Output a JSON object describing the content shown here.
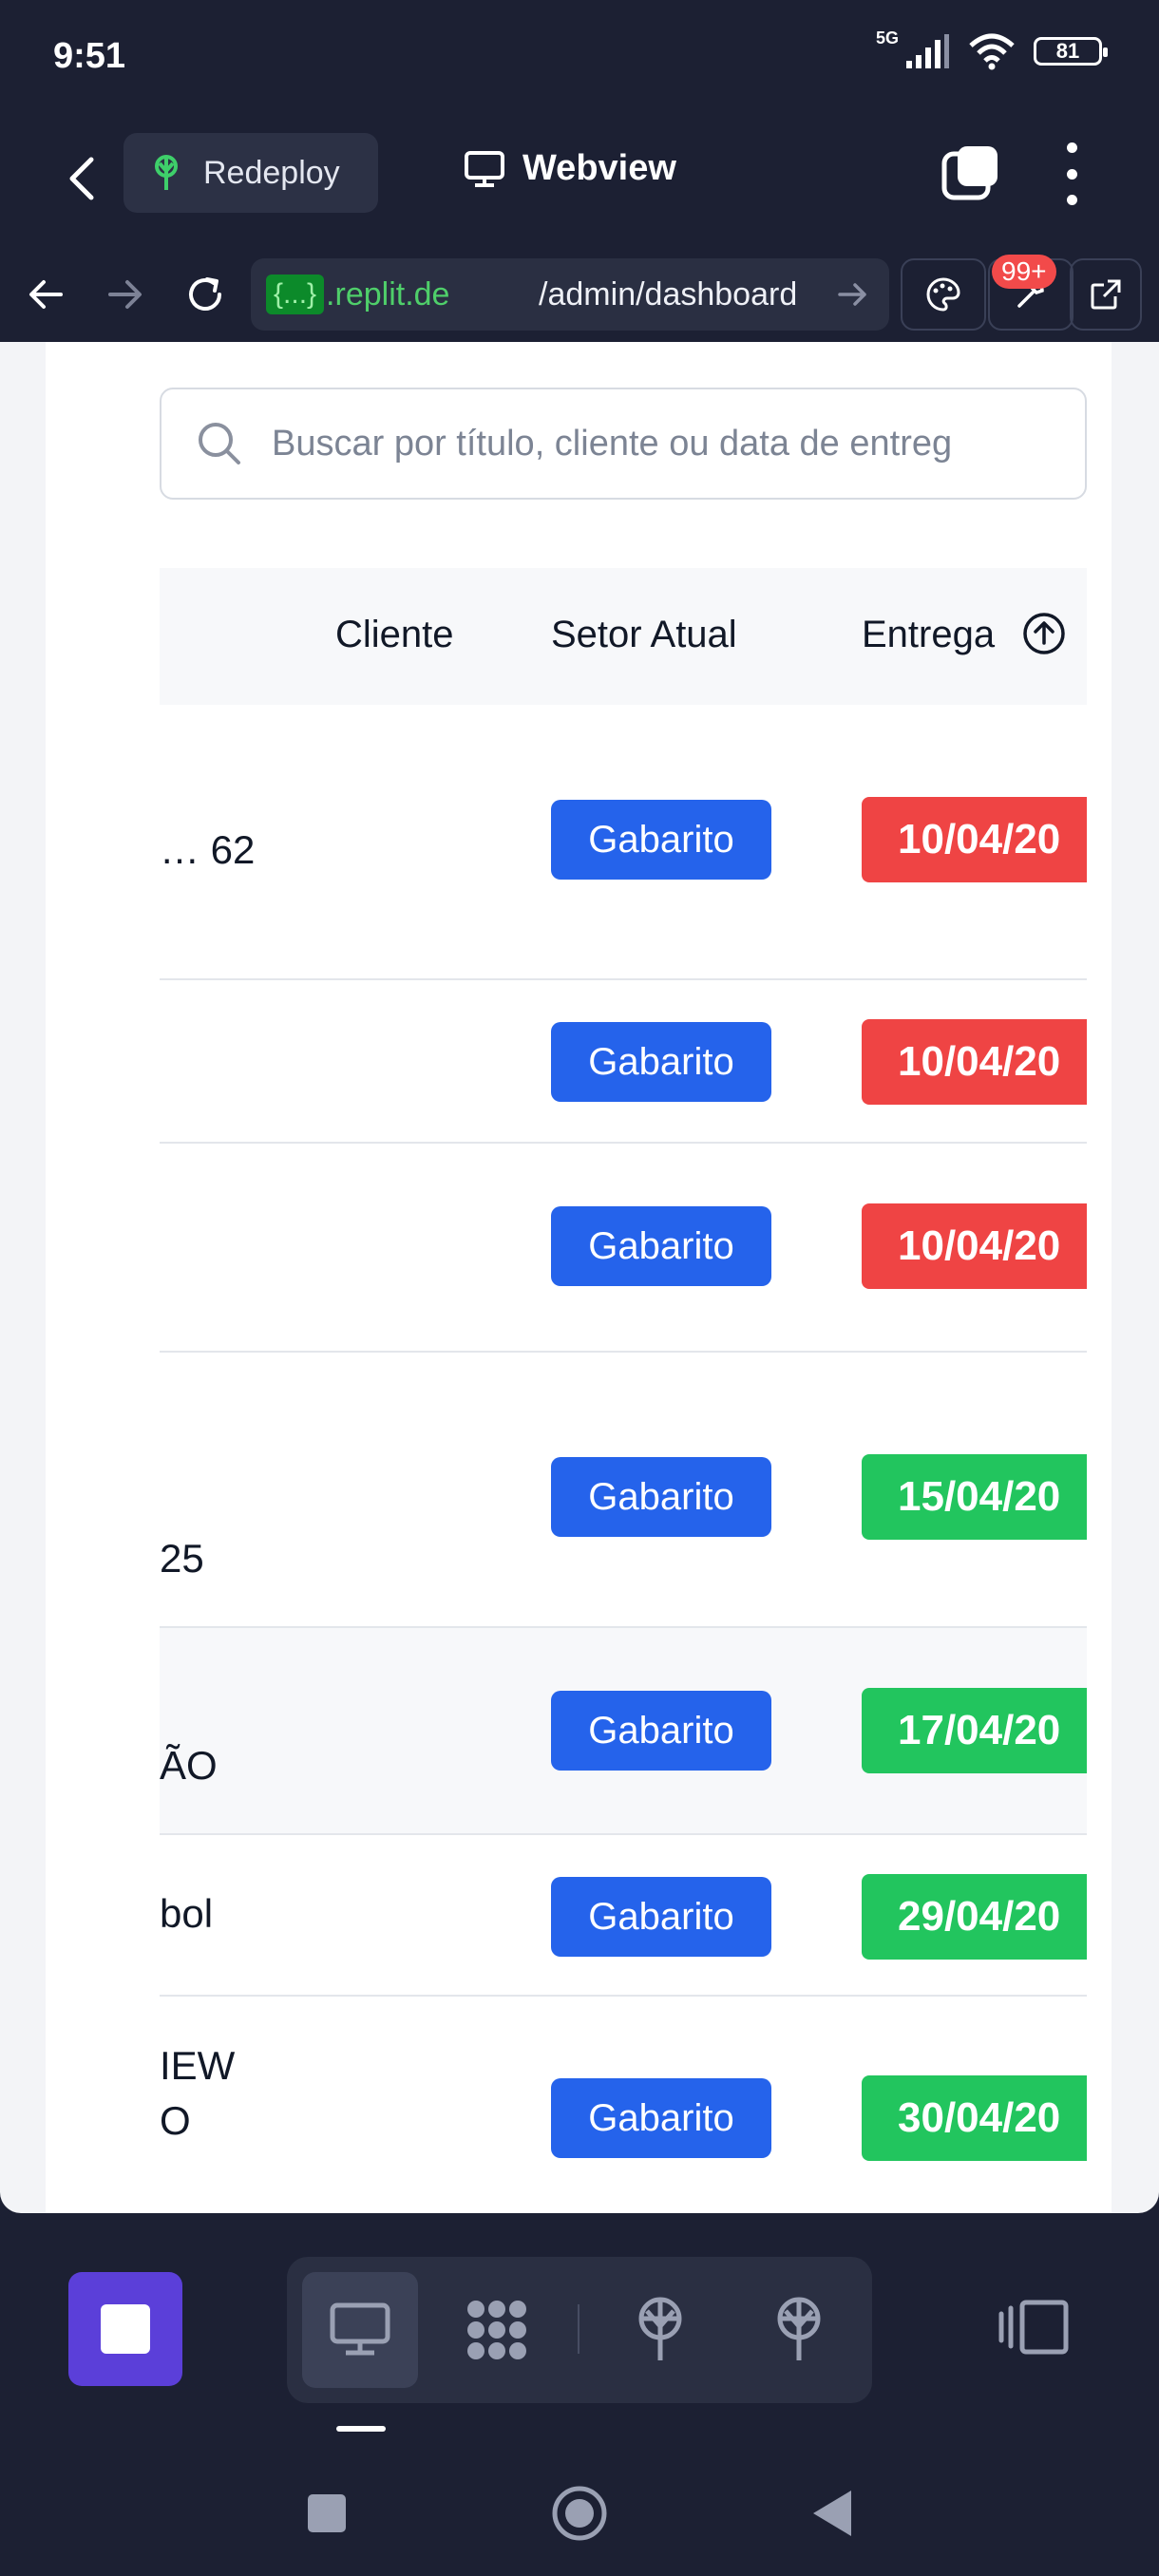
{
  "status": {
    "time": "9:51",
    "network": "5G",
    "battery": "81"
  },
  "app_bar": {
    "redeploy_label": "Redeploy",
    "tab_label": "Webview"
  },
  "url_bar": {
    "brace": "{...}",
    "domain": ".replit.de",
    "path": "/admin/dashboard",
    "badge": "99+"
  },
  "search": {
    "placeholder": "Buscar por título, cliente ou data de entreg"
  },
  "table": {
    "headers": {
      "client": "Cliente",
      "sector": "Setor Atual",
      "due": "Entrega"
    },
    "rows": [
      {
        "title_lines": [
          "… 62"
        ],
        "sector": "Gabarito",
        "due": "10/04/20",
        "status": "overdue"
      },
      {
        "title_lines": [
          ""
        ],
        "sector": "Gabarito",
        "due": "10/04/20",
        "status": "overdue"
      },
      {
        "title_lines": [
          ""
        ],
        "sector": "Gabarito",
        "due": "10/04/20",
        "status": "overdue"
      },
      {
        "title_lines": [
          "25"
        ],
        "sector": "Gabarito",
        "due": "15/04/20",
        "status": "ok"
      },
      {
        "title_lines": [
          "ÃO"
        ],
        "sector": "Gabarito",
        "due": "17/04/20",
        "status": "ok"
      },
      {
        "title_lines": [
          "bol"
        ],
        "sector": "Gabarito",
        "due": "29/04/20",
        "status": "ok"
      },
      {
        "title_lines": [
          "IEW",
          "O"
        ],
        "sector": "Gabarito",
        "due": "30/04/20",
        "status": "ok"
      }
    ]
  },
  "colors": {
    "overdue": "#ef4444",
    "ok": "#22c55e",
    "sector": "#2563eb",
    "accent": "#5b3fd9"
  }
}
